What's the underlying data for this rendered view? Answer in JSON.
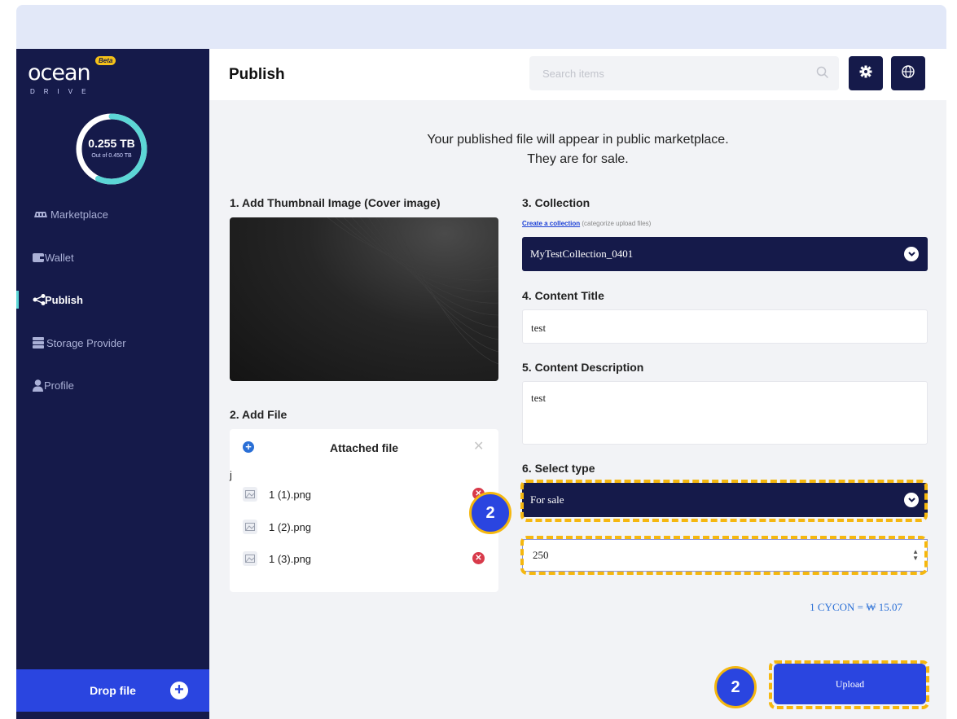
{
  "app": {
    "logo_text": "ocean",
    "logo_sub": "DRIVE",
    "beta": "Beta"
  },
  "storage": {
    "used": "0.255 TB",
    "total": "Out of 0.450 TB",
    "used_fraction": 0.567
  },
  "sidebar": {
    "items": [
      {
        "label": "Marketplace",
        "icon": "marketplace-icon"
      },
      {
        "label": "Wallet",
        "icon": "wallet-icon"
      },
      {
        "label": "Publish",
        "icon": "share-icon",
        "active": true
      },
      {
        "label": "Storage Provider",
        "icon": "server-icon"
      },
      {
        "label": "Profile",
        "icon": "user-icon"
      }
    ],
    "drop_label": "Drop file"
  },
  "header": {
    "title": "Publish",
    "search_placeholder": "Search items"
  },
  "notice": {
    "line1": "Your published file will appear in public marketplace.",
    "line2": "They are for sale."
  },
  "form": {
    "thumb_label": "1. Add Thumbnail Image (Cover image)",
    "file_label": "2. Add File",
    "attached_title": "Attached file",
    "stray_text": "j",
    "files": [
      "1 (1).png",
      "1 (2).png",
      "1 (3).png"
    ],
    "collection_label": "3. Collection",
    "create_collection_link": "Create a collection",
    "create_collection_hint": "(categorize upload files)",
    "collection_value": "MyTestCollection_0401",
    "title_label": "4. Content Title",
    "title_value": "test",
    "desc_label": "5. Content Description",
    "desc_value": "test",
    "type_label": "6. Select type",
    "type_value": "For sale",
    "price_value": "250",
    "rate": "1 CYCON = ₩ 15.07",
    "upload_label": "Upload"
  },
  "annotations": {
    "badge1": "2",
    "badge2": "2",
    "highlight_color": "#f5b70f"
  },
  "colors": {
    "sidebar": "#151a4a",
    "accent": "#2a45e0",
    "ring": "#5cd6d6"
  }
}
